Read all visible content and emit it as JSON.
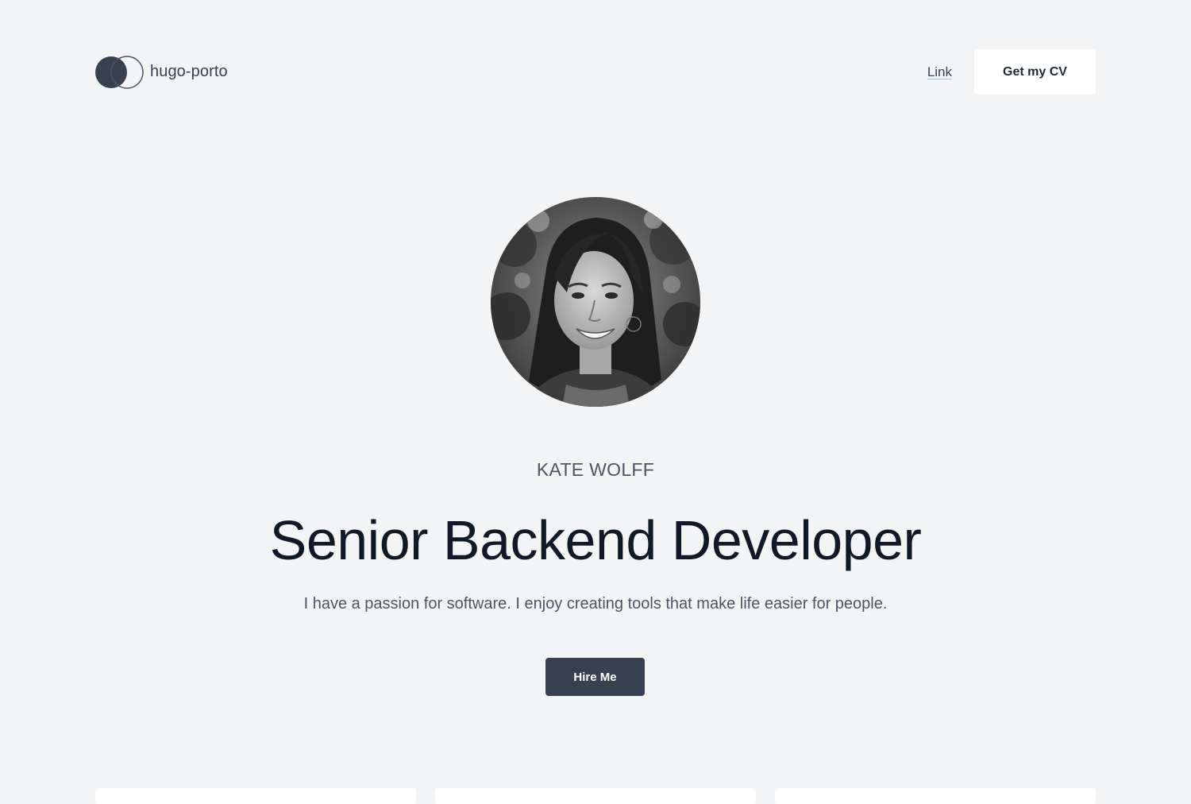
{
  "header": {
    "brand_name": "hugo-porto",
    "nav_link_label": "Link",
    "cv_button_label": "Get my CV"
  },
  "hero": {
    "name": "KATE WOLFF",
    "title": "Senior Backend Developer",
    "tagline": "I have a passion for software. I enjoy creating tools that make life easier for people.",
    "hire_button_label": "Hire Me"
  },
  "icons": {
    "brand_logo": "two-overlapping-circles-logo"
  },
  "colors": {
    "background": "#f3f4f6",
    "primary_dark": "#374151",
    "heading": "#111827",
    "muted_text": "#4b5563",
    "surface": "#ffffff"
  }
}
